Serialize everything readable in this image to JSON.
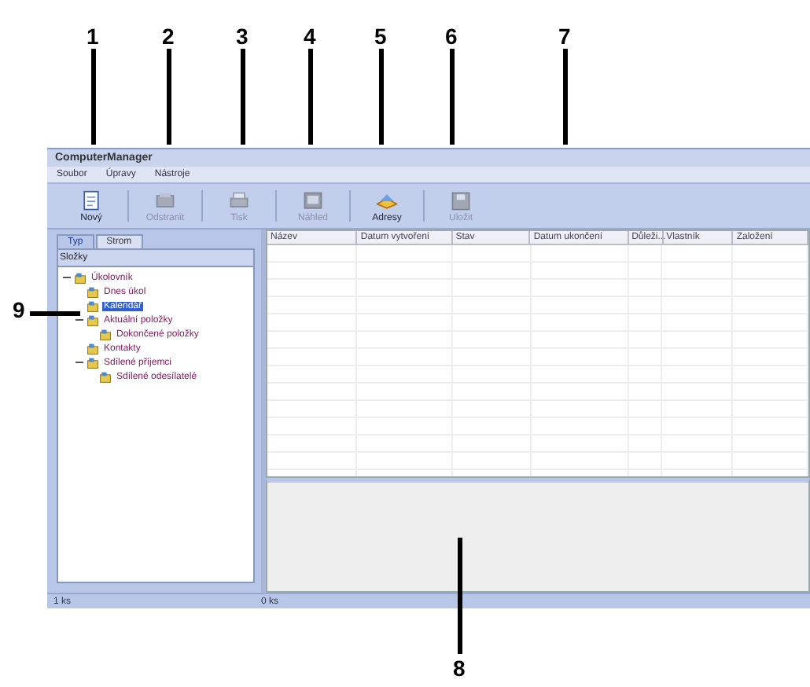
{
  "callouts": [
    {
      "label": "1"
    },
    {
      "label": "2"
    },
    {
      "label": "3"
    },
    {
      "label": "4"
    },
    {
      "label": "5"
    },
    {
      "label": "6"
    },
    {
      "label": "7"
    },
    {
      "label": "8"
    },
    {
      "label": "9"
    }
  ],
  "window": {
    "title": "ComputerManager"
  },
  "menu": [
    {
      "label": "Soubor"
    },
    {
      "label": "Úpravy"
    },
    {
      "label": "Nástroje"
    }
  ],
  "toolbar": [
    {
      "label": "Nový",
      "disabled": false
    },
    {
      "label": "Odstranit",
      "disabled": true
    },
    {
      "label": "Tisk",
      "disabled": true
    },
    {
      "label": "Náhled",
      "disabled": true
    },
    {
      "label": "Adresy",
      "disabled": false
    },
    {
      "label": "Uložit",
      "disabled": true
    }
  ],
  "sidebar": {
    "tabs": [
      {
        "label": "Typ",
        "selected": true
      },
      {
        "label": "Strom",
        "selected": false
      }
    ],
    "heading": "Složky",
    "tree": [
      {
        "label": "Úkolovník",
        "expanded": true,
        "selected": false,
        "children": [
          {
            "label": "Dnes úkol",
            "selected": false
          },
          {
            "label": "Kalendář",
            "selected": true
          },
          {
            "label": "Aktuální položky",
            "selected": false,
            "expanded": true,
            "children": [
              {
                "label": "Dokončené položky",
                "selected": false
              }
            ]
          },
          {
            "label": "Kontakty",
            "selected": false
          },
          {
            "label": "Sdílené příjemci",
            "selected": false,
            "expanded": true,
            "children": [
              {
                "label": "Sdílené odesílatelé",
                "selected": false
              }
            ]
          }
        ]
      }
    ]
  },
  "table": {
    "columns": [
      "Název",
      "Datum vytvoření",
      "Stav",
      "Datum ukončení",
      "Důleži...",
      "Vlastník",
      "Založení"
    ]
  },
  "status_bar": [
    "1 ks",
    "0 ks"
  ]
}
